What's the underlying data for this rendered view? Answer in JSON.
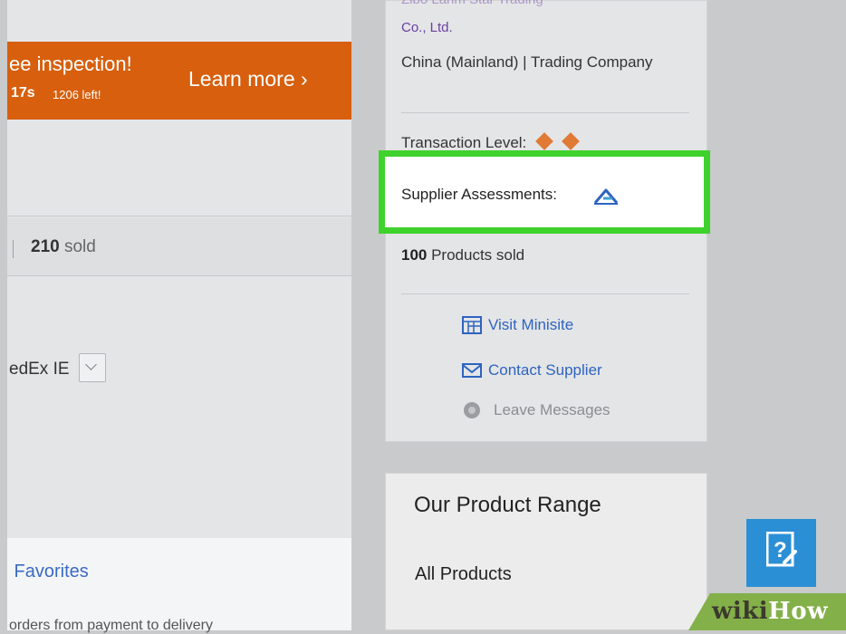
{
  "promo": {
    "title": "ee inspection!",
    "timer": "17s",
    "remaining": "1206 left!",
    "cta": "Learn more ›"
  },
  "sales": {
    "count": "210",
    "unit": " sold"
  },
  "shipping": {
    "method": "edEx IE"
  },
  "favorites": {
    "label": " Favorites"
  },
  "orders_note": "orders from payment to delivery",
  "supplier": {
    "name_fragment": "Zibo Lanm Star Trading",
    "name_end": "Co., Ltd.",
    "location_type": "China (Mainland) | Trading Company",
    "transaction_level_label": "Transaction Level:",
    "transaction_level_diamonds": 2,
    "assessments_label": "Supplier Assessments:",
    "products_sold_count": "100",
    "products_sold_label": " Products sold",
    "visit_minisite": "Visit Minisite",
    "contact_supplier": "Contact Supplier",
    "leave_messages": "Leave Messages"
  },
  "product_range": {
    "title": "Our Product Range",
    "all_products": "All Products"
  },
  "watermark": {
    "wiki": "wiki",
    "how": "How"
  },
  "colors": {
    "promo_bg": "#d75f0d",
    "highlight_border": "#3fd22c",
    "link_blue": "#2d64c0",
    "help_button": "#2b8fd6",
    "watermark_green": "#84b04a"
  },
  "icons": [
    "assessment-icon",
    "minisite-icon",
    "envelope-icon",
    "chat-icon",
    "help-icon",
    "chevron-down-icon",
    "diamond-icon"
  ]
}
